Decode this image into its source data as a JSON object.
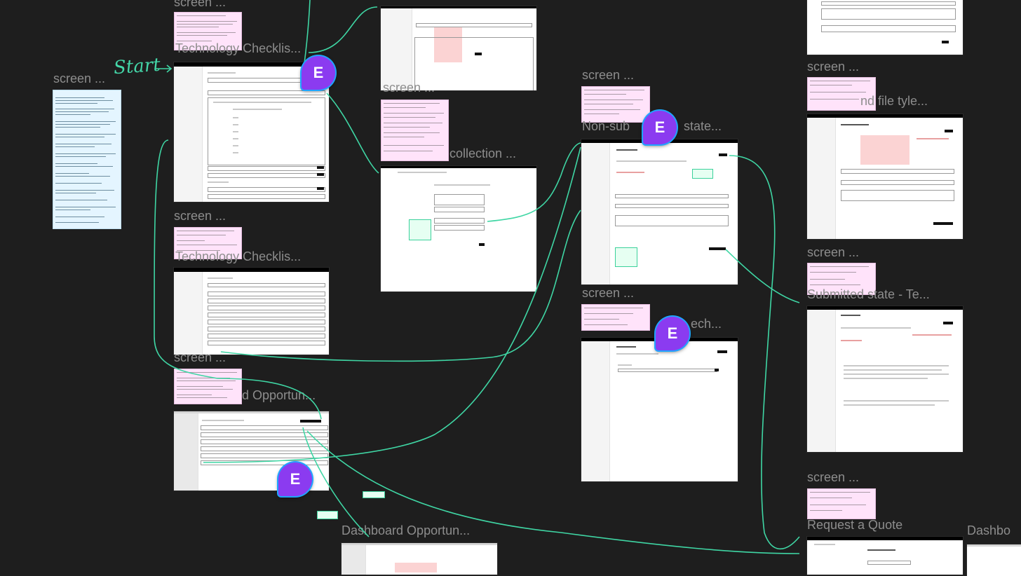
{
  "canvas": {
    "background": "#1e1e1e",
    "connector_color": "#3fd6a4"
  },
  "start_label": "Start",
  "avatar_initial": "E",
  "labels": {
    "screen_top": "screen ...",
    "tech_checklist_1": "Technology Checklis...",
    "screen_left": "screen ...",
    "screen_mid": "screen ...",
    "tech_checklist_2": "Technology Checklis...",
    "screen_low": "screen ...",
    "dash_opportun_1": "d Opportun...",
    "dash_opportun_2": "Dashboard Opportun...",
    "screen_collection": "screen ...",
    "collection": "collection ...",
    "screen_nonsub": "screen ...",
    "nonsub_state": "Non-sub",
    "nonsub_state_tail": "state...",
    "screen_sub_fetch": "screen ...",
    "sub_fetch_tail": "ech...",
    "screen_right_top": "screen ...",
    "file_type": "nd file tyle...",
    "screen_right_mid": "screen ...",
    "submitted_state": "Submitted state - Te...",
    "screen_right_low": "screen ...",
    "request_quote": "Request a Quote",
    "dashbo": "Dashbo"
  }
}
